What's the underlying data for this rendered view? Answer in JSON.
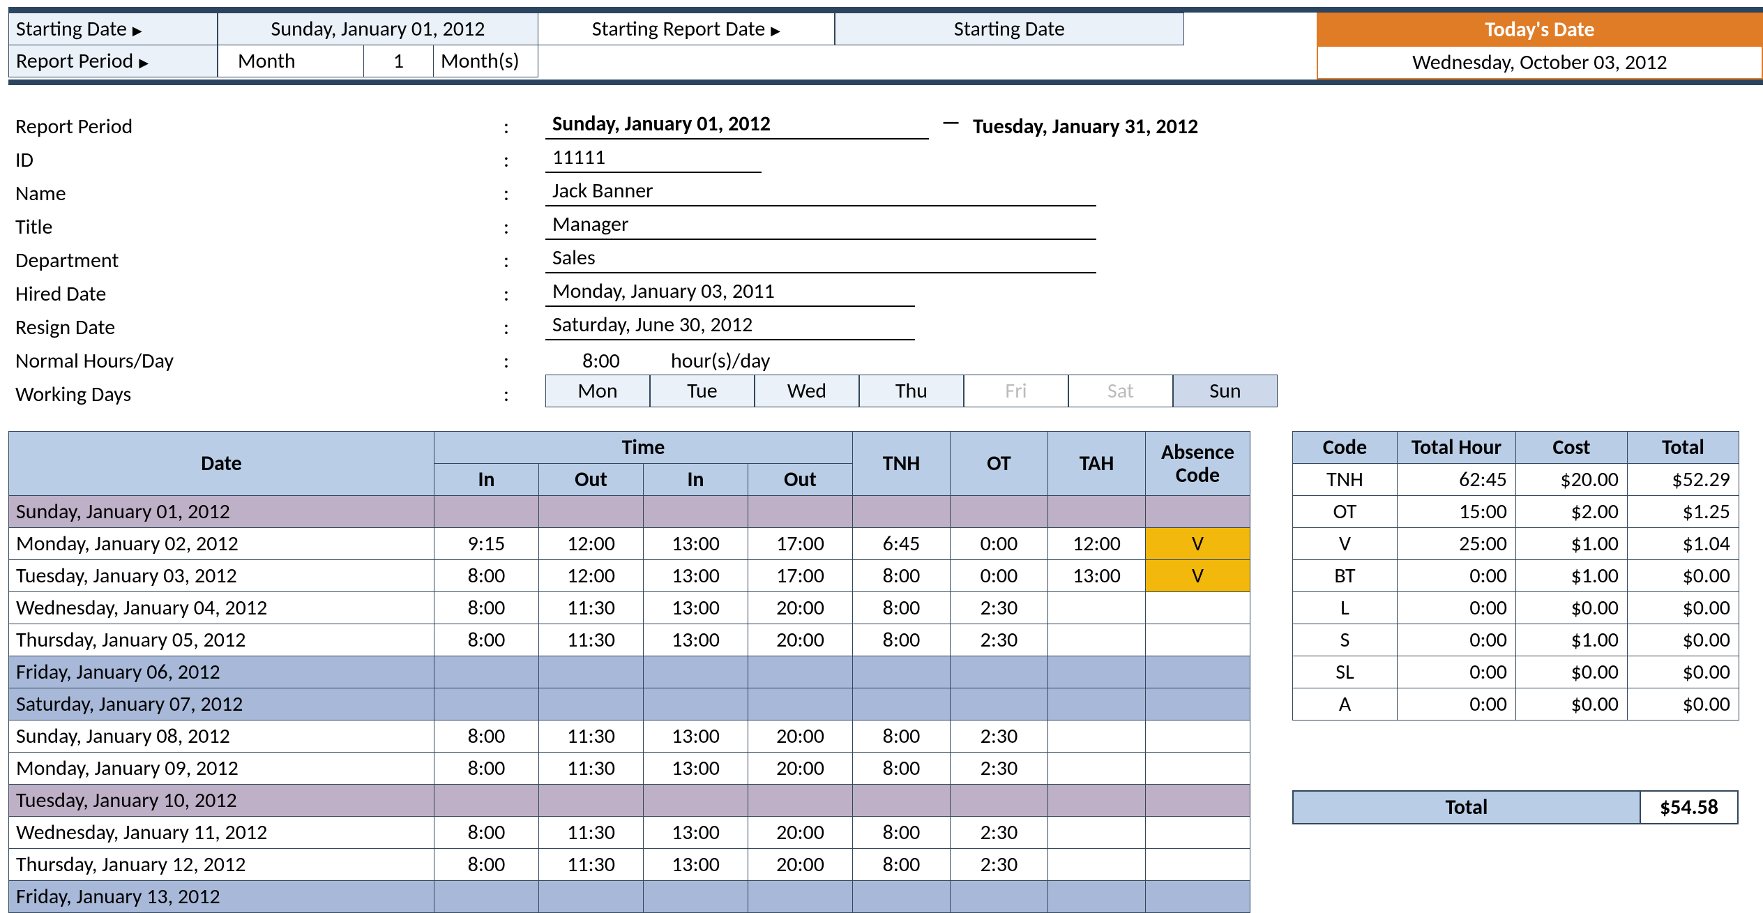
{
  "header": {
    "starting_date_label": "Starting Date",
    "starting_date_value": "Sunday, January 01, 2012",
    "starting_report_date_label": "Starting Report Date",
    "starting_report_value": "Starting Date",
    "report_period_label": "Report Period",
    "report_period_unit": "Month",
    "report_period_count": "1",
    "report_period_units": "Month(s)",
    "todays_date_label": "Today's Date",
    "todays_date_value": "Wednesday, October 03, 2012"
  },
  "info": {
    "report_period_label": "Report Period",
    "report_period_from": "Sunday, January 01, 2012",
    "report_period_to": "Tuesday, January 31, 2012",
    "id_label": "ID",
    "id_value": "11111",
    "name_label": "Name",
    "name_value": "Jack Banner",
    "title_label": "Title",
    "title_value": "Manager",
    "department_label": "Department",
    "department_value": "Sales",
    "hired_label": "Hired Date",
    "hired_value": "Monday, January 03, 2011",
    "resign_label": "Resign Date",
    "resign_value": "Saturday, June 30, 2012",
    "normal_hours_label": "Normal Hours/Day",
    "normal_hours_value": "8:00",
    "normal_hours_unit": "hour(s)/day",
    "working_days_label": "Working Days",
    "days": [
      "Mon",
      "Tue",
      "Wed",
      "Thu",
      "Fri",
      "Sat",
      "Sun"
    ]
  },
  "timesheet": {
    "headers": {
      "date": "Date",
      "time": "Time",
      "in": "In",
      "out": "Out",
      "tnh": "TNH",
      "ot": "OT",
      "tah": "TAH",
      "abs": "Absence Code"
    },
    "rows": [
      {
        "date": "Sunday, January 01, 2012",
        "style": "purple"
      },
      {
        "date": "Monday, January 02, 2012",
        "in1": "9:15",
        "out1": "12:00",
        "in2": "13:00",
        "out2": "17:00",
        "tnh": "6:45",
        "ot": "0:00",
        "tah": "12:00",
        "abs": "V"
      },
      {
        "date": "Tuesday, January 03, 2012",
        "in1": "8:00",
        "out1": "12:00",
        "in2": "13:00",
        "out2": "17:00",
        "tnh": "8:00",
        "ot": "0:00",
        "tah": "13:00",
        "abs": "V"
      },
      {
        "date": "Wednesday, January 04, 2012",
        "in1": "8:00",
        "out1": "11:30",
        "in2": "13:00",
        "out2": "20:00",
        "tnh": "8:00",
        "ot": "2:30"
      },
      {
        "date": "Thursday, January 05, 2012",
        "in1": "8:00",
        "out1": "11:30",
        "in2": "13:00",
        "out2": "20:00",
        "tnh": "8:00",
        "ot": "2:30"
      },
      {
        "date": "Friday, January 06, 2012",
        "style": "blue"
      },
      {
        "date": "Saturday, January 07, 2012",
        "style": "blue"
      },
      {
        "date": "Sunday, January 08, 2012",
        "in1": "8:00",
        "out1": "11:30",
        "in2": "13:00",
        "out2": "20:00",
        "tnh": "8:00",
        "ot": "2:30"
      },
      {
        "date": "Monday, January 09, 2012",
        "in1": "8:00",
        "out1": "11:30",
        "in2": "13:00",
        "out2": "20:00",
        "tnh": "8:00",
        "ot": "2:30"
      },
      {
        "date": "Tuesday, January 10, 2012",
        "style": "purple"
      },
      {
        "date": "Wednesday, January 11, 2012",
        "in1": "8:00",
        "out1": "11:30",
        "in2": "13:00",
        "out2": "20:00",
        "tnh": "8:00",
        "ot": "2:30"
      },
      {
        "date": "Thursday, January 12, 2012",
        "in1": "8:00",
        "out1": "11:30",
        "in2": "13:00",
        "out2": "20:00",
        "tnh": "8:00",
        "ot": "2:30"
      },
      {
        "date": "Friday, January 13, 2012",
        "style": "blue"
      }
    ]
  },
  "summary": {
    "headers": {
      "code": "Code",
      "hour": "Total Hour",
      "cost": "Cost",
      "total": "Total"
    },
    "rows": [
      {
        "code": "TNH",
        "hour": "62:45",
        "cost": "$20.00",
        "total": "$52.29"
      },
      {
        "code": "OT",
        "hour": "15:00",
        "cost": "$2.00",
        "total": "$1.25"
      },
      {
        "code": "V",
        "hour": "25:00",
        "cost": "$1.00",
        "total": "$1.04"
      },
      {
        "code": "BT",
        "hour": "0:00",
        "cost": "$1.00",
        "total": "$0.00"
      },
      {
        "code": "L",
        "hour": "0:00",
        "cost": "$0.00",
        "total": "$0.00"
      },
      {
        "code": "S",
        "hour": "0:00",
        "cost": "$1.00",
        "total": "$0.00"
      },
      {
        "code": "SL",
        "hour": "0:00",
        "cost": "$0.00",
        "total": "$0.00"
      },
      {
        "code": "A",
        "hour": "0:00",
        "cost": "$0.00",
        "total": "$0.00"
      }
    ],
    "grand_total_label": "Total",
    "grand_total_value": "$54.58"
  }
}
